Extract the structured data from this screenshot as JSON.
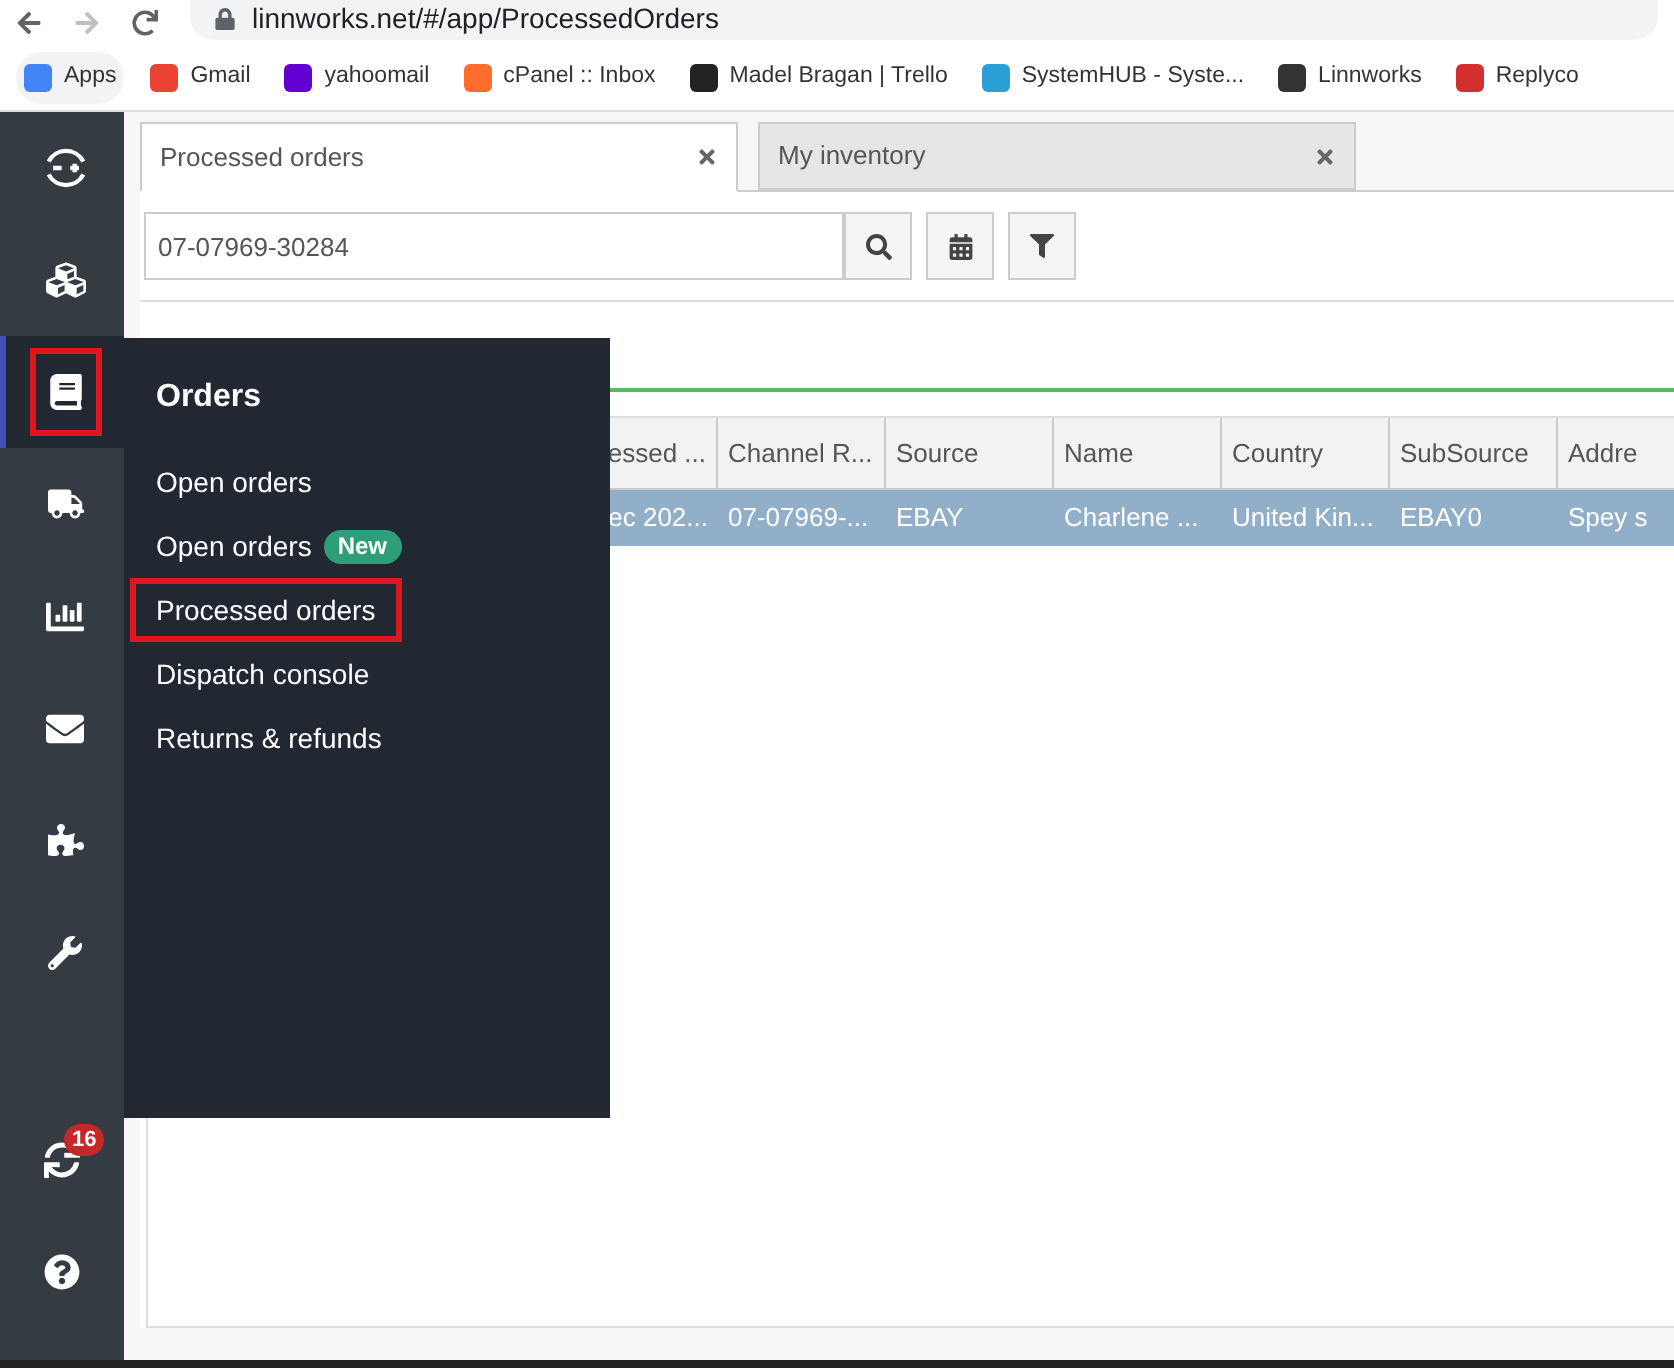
{
  "browser": {
    "url": "linnworks.net/#/app/ProcessedOrders",
    "bookmarks": [
      {
        "label": "Apps",
        "color": "#4285f4"
      },
      {
        "label": "Gmail",
        "color": "#ea4335"
      },
      {
        "label": "yahoomail",
        "color": "#6001d2"
      },
      {
        "label": "cPanel :: Inbox",
        "color": "#ff6c2c"
      },
      {
        "label": "Madel Bragan | Trello",
        "color": "#222222"
      },
      {
        "label": "SystemHUB - Syste...",
        "color": "#2a9fd6"
      },
      {
        "label": "Linnworks",
        "color": "#333333"
      },
      {
        "label": "Replyco",
        "color": "#d32f2f"
      }
    ]
  },
  "sidebar": {
    "items": [
      {
        "kind": "exchange",
        "selected": false,
        "highlighted": false
      },
      {
        "kind": "cubes",
        "selected": false,
        "highlighted": false
      },
      {
        "kind": "book",
        "selected": true,
        "highlighted": true
      },
      {
        "kind": "truck",
        "selected": false,
        "highlighted": false
      },
      {
        "kind": "chart",
        "selected": false,
        "highlighted": false
      },
      {
        "kind": "mail",
        "selected": false,
        "highlighted": false
      },
      {
        "kind": "puzzle",
        "selected": false,
        "highlighted": false
      },
      {
        "kind": "wrench",
        "selected": false,
        "highlighted": false
      }
    ],
    "bottom": [
      {
        "kind": "sync",
        "badge": "16"
      },
      {
        "kind": "help"
      }
    ]
  },
  "flyout": {
    "title": "Orders",
    "items": [
      {
        "label": "Open orders",
        "highlighted": false
      },
      {
        "label": "Open orders",
        "badge": "New",
        "highlighted": false
      },
      {
        "label": "Processed orders",
        "highlighted": true
      },
      {
        "label": "Dispatch console",
        "highlighted": false
      },
      {
        "label": "Returns & refunds",
        "highlighted": false
      }
    ]
  },
  "tabs": [
    {
      "label": "Processed orders",
      "selected": true
    },
    {
      "label": "My inventory",
      "selected": false
    }
  ],
  "search": {
    "value": "07-07969-30284"
  },
  "table": {
    "columns": [
      "essed ...",
      "Channel R...",
      "Source",
      "Name",
      "Country",
      "SubSource",
      "Addre"
    ],
    "rows": [
      {
        "selected": true,
        "cells": [
          "ec 202...",
          "07-07969-...",
          "EBAY",
          "Charlene ...",
          "United Kin...",
          "EBAY0",
          "Spey s"
        ]
      }
    ]
  }
}
